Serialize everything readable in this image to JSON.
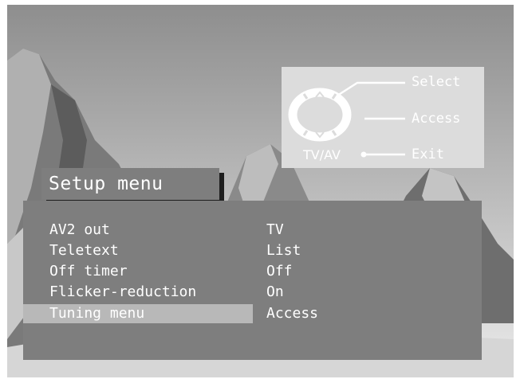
{
  "menu": {
    "title": "Setup menu",
    "items": [
      {
        "label": "AV2 out",
        "value": "TV"
      },
      {
        "label": "Teletext",
        "value": "List"
      },
      {
        "label": "Off timer",
        "value": "Off"
      },
      {
        "label": "Flicker-reduction",
        "value": "On"
      },
      {
        "label": "Tuning menu",
        "value": "Access"
      }
    ],
    "selected_index": 4
  },
  "help": {
    "select": "Select",
    "access": "Access",
    "exit": "Exit",
    "tvav": "TV/AV"
  },
  "colors": {
    "panel": "#7e7e7e",
    "highlight": "#b8b8b8",
    "help_panel": "#dcdcdc",
    "text": "#ffffff"
  },
  "icons": [
    "remote-control-icon",
    "arrow-up-icon",
    "arrow-down-icon",
    "plus-icon"
  ]
}
